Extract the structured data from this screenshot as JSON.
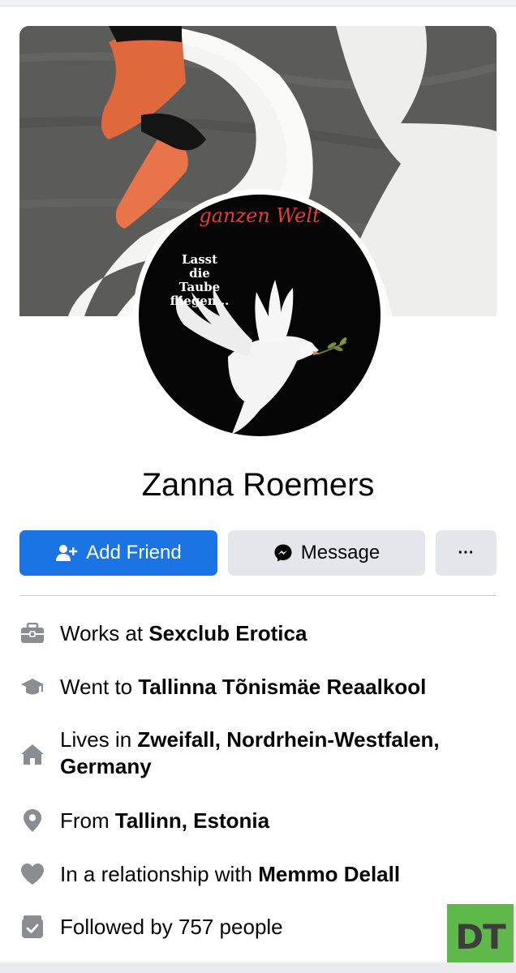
{
  "profile": {
    "name": "Zanna Roemers",
    "avatar_script_text": "ganzen Welt",
    "avatar_text": "Lasst\ndie\nTaube\nfliegen..."
  },
  "actions": {
    "add_friend_label": "Add Friend",
    "message_label": "Message",
    "more_label": "···"
  },
  "intro": {
    "work": {
      "prefix": "Works at ",
      "value": "Sexclub Erotica",
      "icon": "briefcase-icon"
    },
    "education": {
      "prefix": "Went to ",
      "value": "Tallinna Tõnismäe Reaalkool",
      "icon": "graduation-cap-icon"
    },
    "lives": {
      "prefix": "Lives in ",
      "value": "Zweifall, Nordrhein-Westfalen,",
      "value2": "Germany",
      "icon": "home-icon"
    },
    "from": {
      "prefix": "From ",
      "value": "Tallinn, Estonia",
      "icon": "location-pin-icon"
    },
    "relationship": {
      "prefix": "In a relationship with ",
      "value": "Memmo Delall",
      "icon": "heart-icon"
    },
    "followers": {
      "text": "Followed by 757 people",
      "icon": "followers-icon"
    }
  },
  "watermark": {
    "text": "DT",
    "color": "#5fb94a"
  },
  "colors": {
    "primary_button": "#1b74e4",
    "secondary_button": "#e4e6eb",
    "icon_gray": "#8a8d91"
  }
}
